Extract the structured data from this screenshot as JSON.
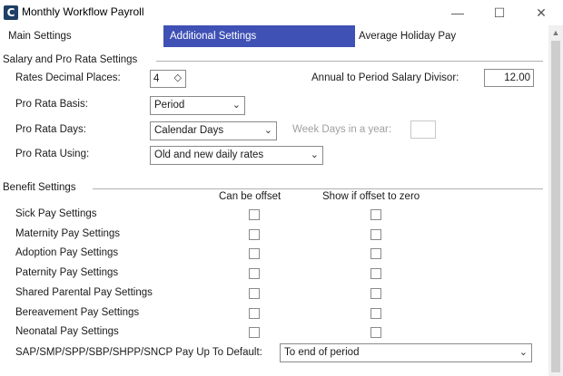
{
  "window": {
    "title": "Monthly Workflow Payroll",
    "app_icon_letter": "C",
    "minimize": "—",
    "maximize": "☐",
    "close": "✕"
  },
  "tabs": {
    "main": "Main Settings",
    "additional": "Additional Settings",
    "average": "Average Holiday Pay"
  },
  "salary": {
    "section_title": "Salary and Pro Rata Settings",
    "rates_decimal_label": "Rates Decimal Places:",
    "rates_decimal_value": "4",
    "divisor_label": "Annual to Period Salary Divisor:",
    "divisor_value": "12.00",
    "basis_label": "Pro Rata Basis:",
    "basis_value": "Period",
    "days_label": "Pro Rata Days:",
    "days_value": "Calendar Days",
    "weekdays_label": "Week Days in a year:",
    "weekdays_value": "",
    "using_label": "Pro Rata Using:",
    "using_value": "Old and new daily rates"
  },
  "benefit": {
    "section_title": "Benefit Settings",
    "col_offset": "Can be offset",
    "col_zero": "Show if offset to zero",
    "rows": [
      {
        "label": "Sick Pay Settings"
      },
      {
        "label": "Maternity Pay Settings"
      },
      {
        "label": "Adoption Pay Settings"
      },
      {
        "label": "Paternity Pay Settings"
      },
      {
        "label": "Shared Parental Pay Settings"
      },
      {
        "label": "Bereavement Pay Settings"
      },
      {
        "label": "Neonatal Pay Settings"
      }
    ],
    "payup_label": "SAP/SMP/SPP/SBP/SHPP/SNCP Pay Up To Default:",
    "payup_value": "To end of period"
  }
}
